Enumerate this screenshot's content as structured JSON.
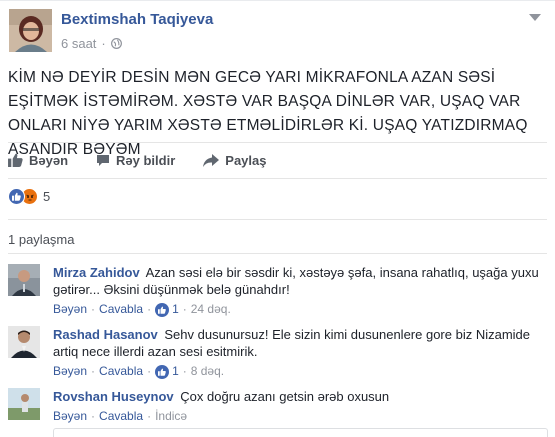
{
  "post": {
    "author": "Bextimshah Taqiyeva",
    "time": "6 saat",
    "text": "KİM NƏ DEYİR DESİN MƏN GECƏ YARI MİKRAFONLA AZAN SƏSİ EŞİTMƏK İSTƏMİRƏM. XƏSTƏ VAR BAŞQA DİNLƏR VAR, UŞAQ VAR ONLARI NİYƏ YARIM XƏSTƏ ETMƏLİDİRLƏR Kİ. UŞAQ YATIZDIRMAQ ASANDIR BƏYƏM"
  },
  "actions": {
    "like": "Bəyən",
    "comment": "Rəy bildir",
    "share": "Paylaş"
  },
  "reactions": {
    "count": "5"
  },
  "shares": "1 paylaşma",
  "comments": [
    {
      "name": "Mirza Zahidov",
      "text": "Azan səsi elə bir səsdir ki, xəstəyə şəfa, insana rahatlıq, uşağa yuxu gətirər... Əksini düşünmək belə günahdır!",
      "like": "Bəyən",
      "reply": "Cavabla",
      "likes": "1",
      "time": "24 dəq."
    },
    {
      "name": "Rashad Hasanov",
      "text": "Sehv dusunursuz! Ele sizin kimi dusunenlere gore biz Nizamide artiq nece illerdi azan sesi esitmirik.",
      "like": "Bəyən",
      "reply": "Cavabla",
      "likes": "1",
      "time": "8 dəq."
    },
    {
      "name": "Rovshan Huseynov",
      "text": "Çox doğru azanı getsin ərəb oxusun",
      "like": "Bəyən",
      "reply": "Cavabla",
      "time": "İndicə"
    }
  ],
  "colors": {
    "link": "#365899",
    "like_blue": "#4267b2",
    "angry_orange": "#e9710f",
    "muted": "#90949c"
  }
}
